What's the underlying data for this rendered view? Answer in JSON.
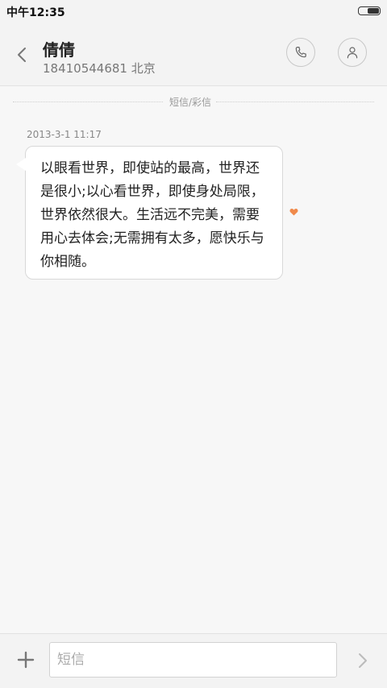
{
  "status_bar": {
    "time": "中午12:35"
  },
  "header": {
    "contact_name": "倩倩",
    "contact_detail": "18410544681 北京",
    "icons": {
      "back": "chevron-left-icon",
      "call": "phone-icon",
      "contact": "person-icon"
    }
  },
  "conversation": {
    "divider_label": "短信/彩信",
    "messages": [
      {
        "timestamp": "2013-3-1 11:17",
        "text": "以眼看世界，即使站的最高，世界还是很小;以心看世界，即使身处局限，世界依然很大。生活远不完美，需要用心去体会;无需拥有太多，愿快乐与你相随。",
        "favorite_icon": "heart-icon"
      }
    ]
  },
  "compose": {
    "placeholder": "短信",
    "value": "",
    "icons": {
      "add": "plus-icon",
      "send": "chevron-right-icon"
    }
  },
  "colors": {
    "background": "#f7f7f7",
    "bar": "#f3f3f3",
    "heart": "#f08a4b",
    "icon_gray": "#777777"
  }
}
